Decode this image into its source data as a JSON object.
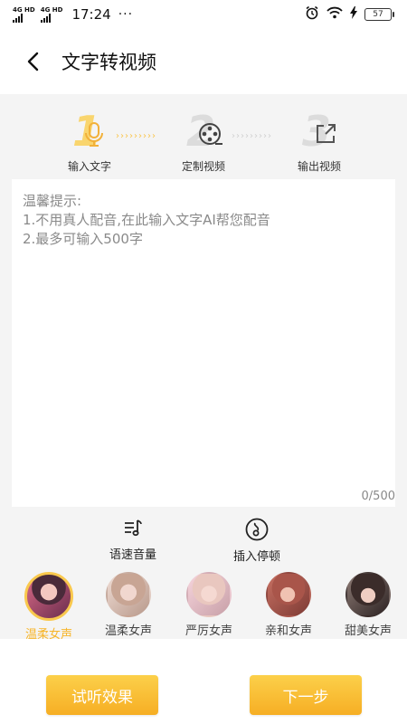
{
  "status_bar": {
    "signal1": "4G HD",
    "signal2": "4G HD",
    "time": "17:24",
    "more": "···",
    "battery": "57"
  },
  "header": {
    "title": "文字转视频"
  },
  "steps": [
    {
      "number": "1",
      "label": "输入文字",
      "icon": "microphone-icon",
      "active": true
    },
    {
      "number": "2",
      "label": "定制视频",
      "icon": "film-reel-icon",
      "active": false
    },
    {
      "number": "3",
      "label": "输出视频",
      "icon": "export-icon",
      "active": false
    }
  ],
  "step_dots": "›››››››››",
  "editor": {
    "hint_title": "温馨提示:",
    "hint_line1": "1.不用真人配音,在此输入文字AI帮您配音",
    "hint_line2": "2.最多可输入500字",
    "counter": "0/500"
  },
  "tools": [
    {
      "label": "语速音量",
      "icon": "speed-volume-icon"
    },
    {
      "label": "插入停顿",
      "icon": "pause-insert-icon"
    }
  ],
  "voices": [
    {
      "name": "温柔女声",
      "active": true
    },
    {
      "name": "温柔女声",
      "active": false
    },
    {
      "name": "严厉女声",
      "active": false
    },
    {
      "name": "亲和女声",
      "active": false
    },
    {
      "name": "甜美女声",
      "active": false
    }
  ],
  "buttons": {
    "preview": "试听效果",
    "next": "下一步"
  },
  "colors": {
    "accent": "#f7b52a",
    "accent_light": "#f9d56e",
    "inactive": "#dcdcdc"
  }
}
